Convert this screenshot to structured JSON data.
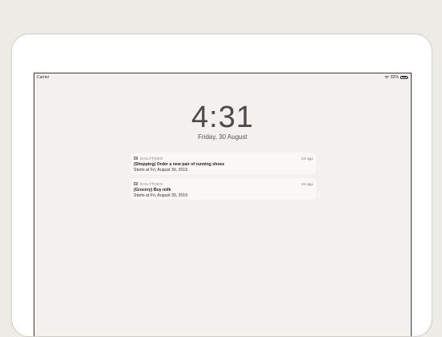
{
  "status_bar": {
    "carrier": "Carrier",
    "battery": "82%",
    "battery_level": 0.82
  },
  "lock_screen": {
    "time": "4:31",
    "date": "Friday, 30 August"
  },
  "notifications": [
    {
      "app": "DAILYTODO",
      "time_ago": "1m ago",
      "title": "(Shopping) Order a new pair of running shoes",
      "body": "Starts at Fri, August 30, 2019"
    },
    {
      "app": "DAILYTODO",
      "time_ago": "1m ago",
      "title": "(Grocery) Buy milk",
      "body": "Starts at Fri, August 30, 2019"
    }
  ],
  "icons": {
    "wifi": "wifi-icon",
    "battery": "battery-icon",
    "app": "app-icon"
  }
}
